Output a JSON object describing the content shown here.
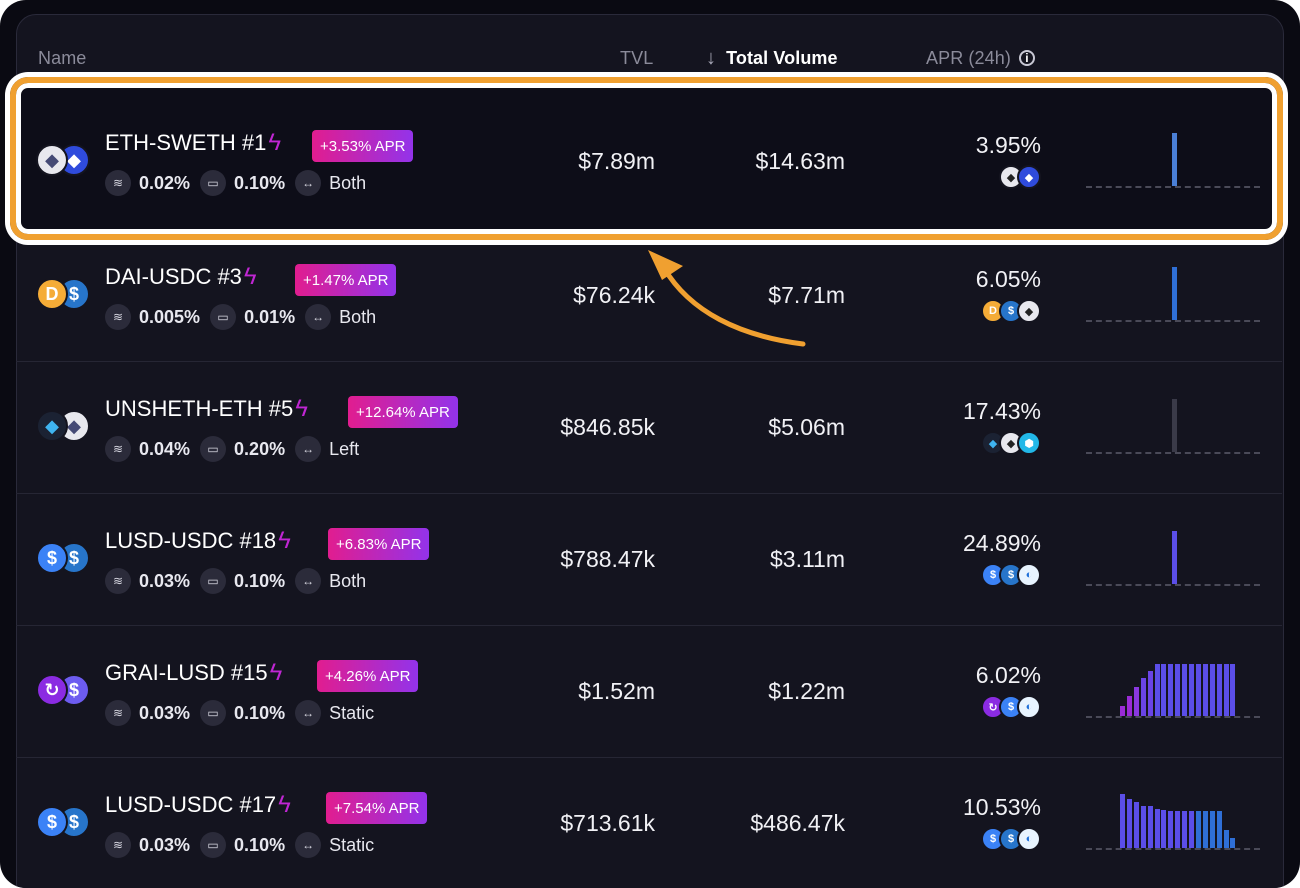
{
  "header": {
    "name": "Name",
    "tvl": "TVL",
    "volume": "Total Volume",
    "apr": "APR (24h)",
    "info": "i"
  },
  "rows": [
    {
      "pair": "ETH-SWETH #1",
      "apr_badge": "+3.53% APR",
      "fee": "0.02%",
      "range": "0.10%",
      "mode": "Both",
      "tvl": "$7.89m",
      "volume": "$14.63m",
      "apr": "3.95%",
      "coins": [
        {
          "icon": "eth-icon",
          "bg": "#e8e8ee",
          "fg": "#454a75",
          "g": "◆"
        },
        {
          "icon": "sweth-icon",
          "bg": "#2f4bdc",
          "fg": "#fff",
          "g": "◆"
        }
      ],
      "rewards": [
        {
          "icon": "eth-icon",
          "bg": "#e8e8ee",
          "fg": "#222",
          "g": "◆"
        },
        {
          "icon": "sweth-icon",
          "bg": "#2f4bdc",
          "fg": "#fff",
          "g": "◆"
        }
      ],
      "spark": [
        {
          "h": 0.78,
          "c": "#4a7fd6"
        }
      ]
    },
    {
      "pair": "DAI-USDC #3",
      "apr_badge": "+1.47% APR",
      "fee": "0.005%",
      "range": "0.01%",
      "mode": "Both",
      "tvl": "$76.24k",
      "volume": "$7.71m",
      "apr": "6.05%",
      "coins": [
        {
          "icon": "dai-icon",
          "bg": "#f5ac37",
          "fg": "#fff",
          "g": "D"
        },
        {
          "icon": "usdc-icon",
          "bg": "#2775ca",
          "fg": "#fff",
          "g": "$"
        }
      ],
      "rewards": [
        {
          "icon": "dai-icon",
          "bg": "#f5ac37",
          "fg": "#fff",
          "g": "D"
        },
        {
          "icon": "usdc-icon",
          "bg": "#2775ca",
          "fg": "#fff",
          "g": "$"
        },
        {
          "icon": "eth-icon",
          "bg": "#e8e8ee",
          "fg": "#222",
          "g": "◆"
        }
      ],
      "spark": [
        {
          "h": 0.78,
          "c": "#2f6fd6"
        }
      ]
    },
    {
      "pair": "UNSHETH-ETH #5",
      "apr_badge": "+12.64% APR",
      "fee": "0.04%",
      "range": "0.20%",
      "mode": "Left",
      "tvl": "$846.85k",
      "volume": "$5.06m",
      "apr": "17.43%",
      "coins": [
        {
          "icon": "unsheth-icon",
          "bg": "#1b2233",
          "fg": "#3fb4f0",
          "g": "◆"
        },
        {
          "icon": "eth-icon",
          "bg": "#e8e8ee",
          "fg": "#454a75",
          "g": "◆"
        }
      ],
      "rewards": [
        {
          "icon": "unsheth-icon",
          "bg": "#1b2233",
          "fg": "#3fb4f0",
          "g": "◆"
        },
        {
          "icon": "eth-icon",
          "bg": "#e8e8ee",
          "fg": "#222",
          "g": "◆"
        },
        {
          "icon": "hex-icon",
          "bg": "#22b8e8",
          "fg": "#fff",
          "g": "⬢"
        }
      ],
      "spark": [
        {
          "h": 0.78,
          "c": "#3a3a48"
        }
      ]
    },
    {
      "pair": "LUSD-USDC #18",
      "apr_badge": "+6.83% APR",
      "fee": "0.03%",
      "range": "0.10%",
      "mode": "Both",
      "tvl": "$788.47k",
      "volume": "$3.11m",
      "apr": "24.89%",
      "coins": [
        {
          "icon": "lusd-icon",
          "bg": "#3b82f6",
          "fg": "#fff",
          "g": "$"
        },
        {
          "icon": "usdc-icon",
          "bg": "#2775ca",
          "fg": "#fff",
          "g": "$"
        }
      ],
      "rewards": [
        {
          "icon": "lusd-icon",
          "bg": "#3b82f6",
          "fg": "#fff",
          "g": "$"
        },
        {
          "icon": "usdc-icon",
          "bg": "#2775ca",
          "fg": "#fff",
          "g": "$"
        },
        {
          "icon": "crescent-icon",
          "bg": "#e8f4ff",
          "fg": "#1e6fd9",
          "g": "◐"
        }
      ],
      "spark": [
        {
          "h": 0.78,
          "c": "#5b4ee8"
        }
      ]
    },
    {
      "pair": "GRAI-LUSD #15",
      "apr_badge": "+4.26% APR",
      "fee": "0.03%",
      "range": "0.10%",
      "mode": "Static",
      "tvl": "$1.52m",
      "volume": "$1.22m",
      "apr": "6.02%",
      "coins": [
        {
          "icon": "grai-icon",
          "bg": "#8b2be2",
          "fg": "#fff",
          "g": "↻"
        },
        {
          "icon": "lusd-icon",
          "bg": "#6d5cf0",
          "fg": "#fff",
          "g": "$"
        }
      ],
      "rewards": [
        {
          "icon": "grai-icon",
          "bg": "#8b2be2",
          "fg": "#fff",
          "g": "↻"
        },
        {
          "icon": "lusd-icon",
          "bg": "#3b82f6",
          "fg": "#fff",
          "g": "$"
        },
        {
          "icon": "crescent-icon",
          "bg": "#e8f4ff",
          "fg": "#1e6fd9",
          "g": "◐"
        }
      ],
      "spark": [
        {
          "h": 0.14,
          "c": "#9a2bd6"
        },
        {
          "h": 0.3,
          "c": "#9a2bd6"
        },
        {
          "h": 0.42,
          "c": "#8a38e0"
        },
        {
          "h": 0.56,
          "c": "#6a44e6"
        },
        {
          "h": 0.66,
          "c": "#6a44e6"
        },
        {
          "h": 0.76,
          "c": "#5b4ee8"
        },
        {
          "h": 0.76,
          "c": "#5b4ee8"
        },
        {
          "h": 0.76,
          "c": "#5b4ee8"
        },
        {
          "h": 0.76,
          "c": "#5b4ee8"
        },
        {
          "h": 0.76,
          "c": "#5b4ee8"
        },
        {
          "h": 0.76,
          "c": "#5b4ee8"
        },
        {
          "h": 0.76,
          "c": "#5b4ee8"
        },
        {
          "h": 0.76,
          "c": "#5b4ee8"
        },
        {
          "h": 0.76,
          "c": "#5b4ee8"
        },
        {
          "h": 0.76,
          "c": "#5b4ee8"
        },
        {
          "h": 0.76,
          "c": "#5b4ee8"
        },
        {
          "h": 0.76,
          "c": "#5b4ee8"
        }
      ]
    },
    {
      "pair": "LUSD-USDC #17",
      "apr_badge": "+7.54% APR",
      "fee": "0.03%",
      "range": "0.10%",
      "mode": "Static",
      "tvl": "$713.61k",
      "volume": "$486.47k",
      "apr": "10.53%",
      "coins": [
        {
          "icon": "lusd-icon",
          "bg": "#3b82f6",
          "fg": "#fff",
          "g": "$"
        },
        {
          "icon": "usdc-icon",
          "bg": "#2775ca",
          "fg": "#fff",
          "g": "$"
        }
      ],
      "rewards": [
        {
          "icon": "lusd-icon",
          "bg": "#3b82f6",
          "fg": "#fff",
          "g": "$"
        },
        {
          "icon": "usdc-icon",
          "bg": "#2775ca",
          "fg": "#fff",
          "g": "$"
        },
        {
          "icon": "crescent-icon",
          "bg": "#e8f4ff",
          "fg": "#1e6fd9",
          "g": "◐"
        }
      ],
      "spark": [
        {
          "h": 0.8,
          "c": "#5b4ee8"
        },
        {
          "h": 0.72,
          "c": "#5b4ee8"
        },
        {
          "h": 0.68,
          "c": "#5b4ee8"
        },
        {
          "h": 0.62,
          "c": "#5b4ee8"
        },
        {
          "h": 0.62,
          "c": "#5b4ee8"
        },
        {
          "h": 0.58,
          "c": "#5b4ee8"
        },
        {
          "h": 0.56,
          "c": "#5b4ee8"
        },
        {
          "h": 0.54,
          "c": "#5b4ee8"
        },
        {
          "h": 0.54,
          "c": "#5b4ee8"
        },
        {
          "h": 0.54,
          "c": "#5b4ee8"
        },
        {
          "h": 0.54,
          "c": "#5b4ee8"
        },
        {
          "h": 0.54,
          "c": "#2f6fd6"
        },
        {
          "h": 0.54,
          "c": "#2f6fd6"
        },
        {
          "h": 0.54,
          "c": "#2f6fd6"
        },
        {
          "h": 0.54,
          "c": "#2f6fd6"
        },
        {
          "h": 0.26,
          "c": "#2f6fd6"
        },
        {
          "h": 0.14,
          "c": "#2f6fd6"
        }
      ]
    }
  ],
  "colors": {
    "highlight": "#f0a030",
    "badge_start": "#e11d8f",
    "badge_end": "#9333ea",
    "bolt": "#c026d3"
  },
  "icons": {
    "fee": "coins-stack-icon",
    "range": "ruler-icon",
    "mode": "arrows-horizontal-icon",
    "sort": "arrow-down-icon",
    "bolt": "lightning-icon"
  }
}
